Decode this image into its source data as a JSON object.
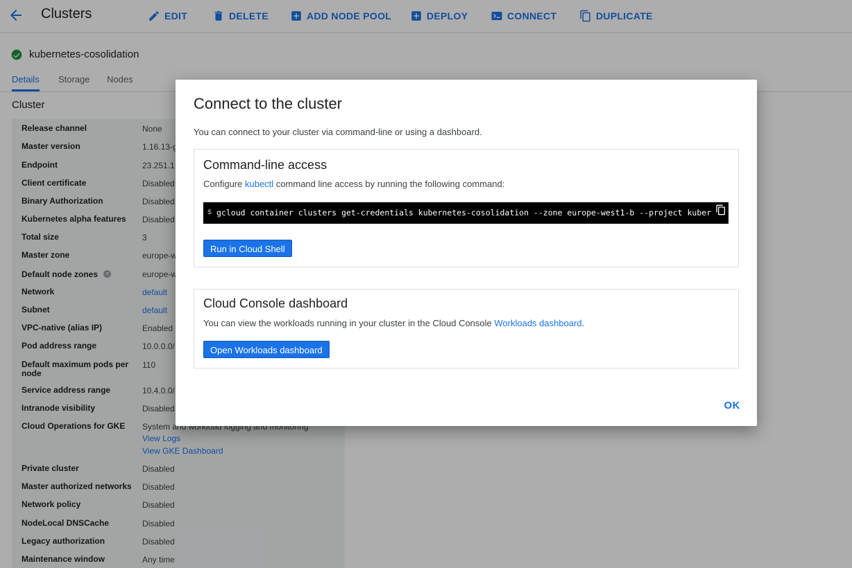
{
  "header": {
    "title": "Clusters",
    "actions": [
      {
        "label": "EDIT",
        "icon": "pencil-icon"
      },
      {
        "label": "DELETE",
        "icon": "trash-icon"
      },
      {
        "label": "ADD NODE POOL",
        "icon": "add-box-icon"
      },
      {
        "label": "DEPLOY",
        "icon": "deploy-icon"
      },
      {
        "label": "CONNECT",
        "icon": "terminal-icon"
      },
      {
        "label": "DUPLICATE",
        "icon": "copy-icon"
      }
    ]
  },
  "cluster": {
    "name": "kubernetes-cosolidation",
    "status_color": "#1e8e3e"
  },
  "tabs": [
    {
      "label": "Details",
      "active": true
    },
    {
      "label": "Storage",
      "active": false
    },
    {
      "label": "Nodes",
      "active": false
    }
  ],
  "section": {
    "title": "Cluster"
  },
  "properties": [
    {
      "key": "Release channel",
      "value": "None"
    },
    {
      "key": "Master version",
      "value": "1.16.13-g"
    },
    {
      "key": "Endpoint",
      "value": "23.251.1"
    },
    {
      "key": "Client certificate",
      "value": "Disabled"
    },
    {
      "key": "Binary Authorization",
      "value": "Disabled"
    },
    {
      "key": "Kubernetes alpha features",
      "value": "Disabled"
    },
    {
      "key": "Total size",
      "value": "3"
    },
    {
      "key": "Master zone",
      "value": "europe-w"
    },
    {
      "key": "Default node zones",
      "value": "europe-w"
    },
    {
      "key": "Network",
      "value": "default"
    },
    {
      "key": "Subnet",
      "value": "default"
    },
    {
      "key": "VPC-native (alias IP)",
      "value": "Enabled"
    },
    {
      "key": "Pod address range",
      "value": "10.0.0.0/"
    },
    {
      "key": "Default maximum pods per node",
      "value": "110"
    },
    {
      "key": "Service address range",
      "value": "10.4.0.0/"
    },
    {
      "key": "Intranode visibility",
      "value": "Disabled"
    },
    {
      "key": "Cloud Operations for GKE",
      "value": "System and workload logging and monitoring",
      "link1": "View Logs",
      "link2": "View GKE Dashboard"
    },
    {
      "key": "Private cluster",
      "value": "Disabled"
    },
    {
      "key": "Master authorized networks",
      "value": "Disabled"
    },
    {
      "key": "Network policy",
      "value": "Disabled"
    },
    {
      "key": "NodeLocal DNSCache",
      "value": "Disabled"
    },
    {
      "key": "Legacy authorization",
      "value": "Disabled"
    },
    {
      "key": "Maintenance window",
      "value": "Any time"
    }
  ],
  "dialog": {
    "title": "Connect to the cluster",
    "intro": "You can connect to your cluster via command-line or using a dashboard.",
    "cli": {
      "title": "Command-line access",
      "text_before": "Configure ",
      "link": "kubectl",
      "text_after": " command line access by running the following command:",
      "prompt": "$",
      "command": "gcloud container clusters get-credentials kubernetes-cosolidation --zone europe-west1-b --project kuber",
      "button": "Run in Cloud Shell"
    },
    "dashboard": {
      "title": "Cloud Console dashboard",
      "text_before": "You can view the workloads running in your cluster in the Cloud Console ",
      "link": "Workloads dashboard",
      "text_after": ".",
      "button": "Open Workloads dashboard"
    },
    "ok": "OK"
  }
}
